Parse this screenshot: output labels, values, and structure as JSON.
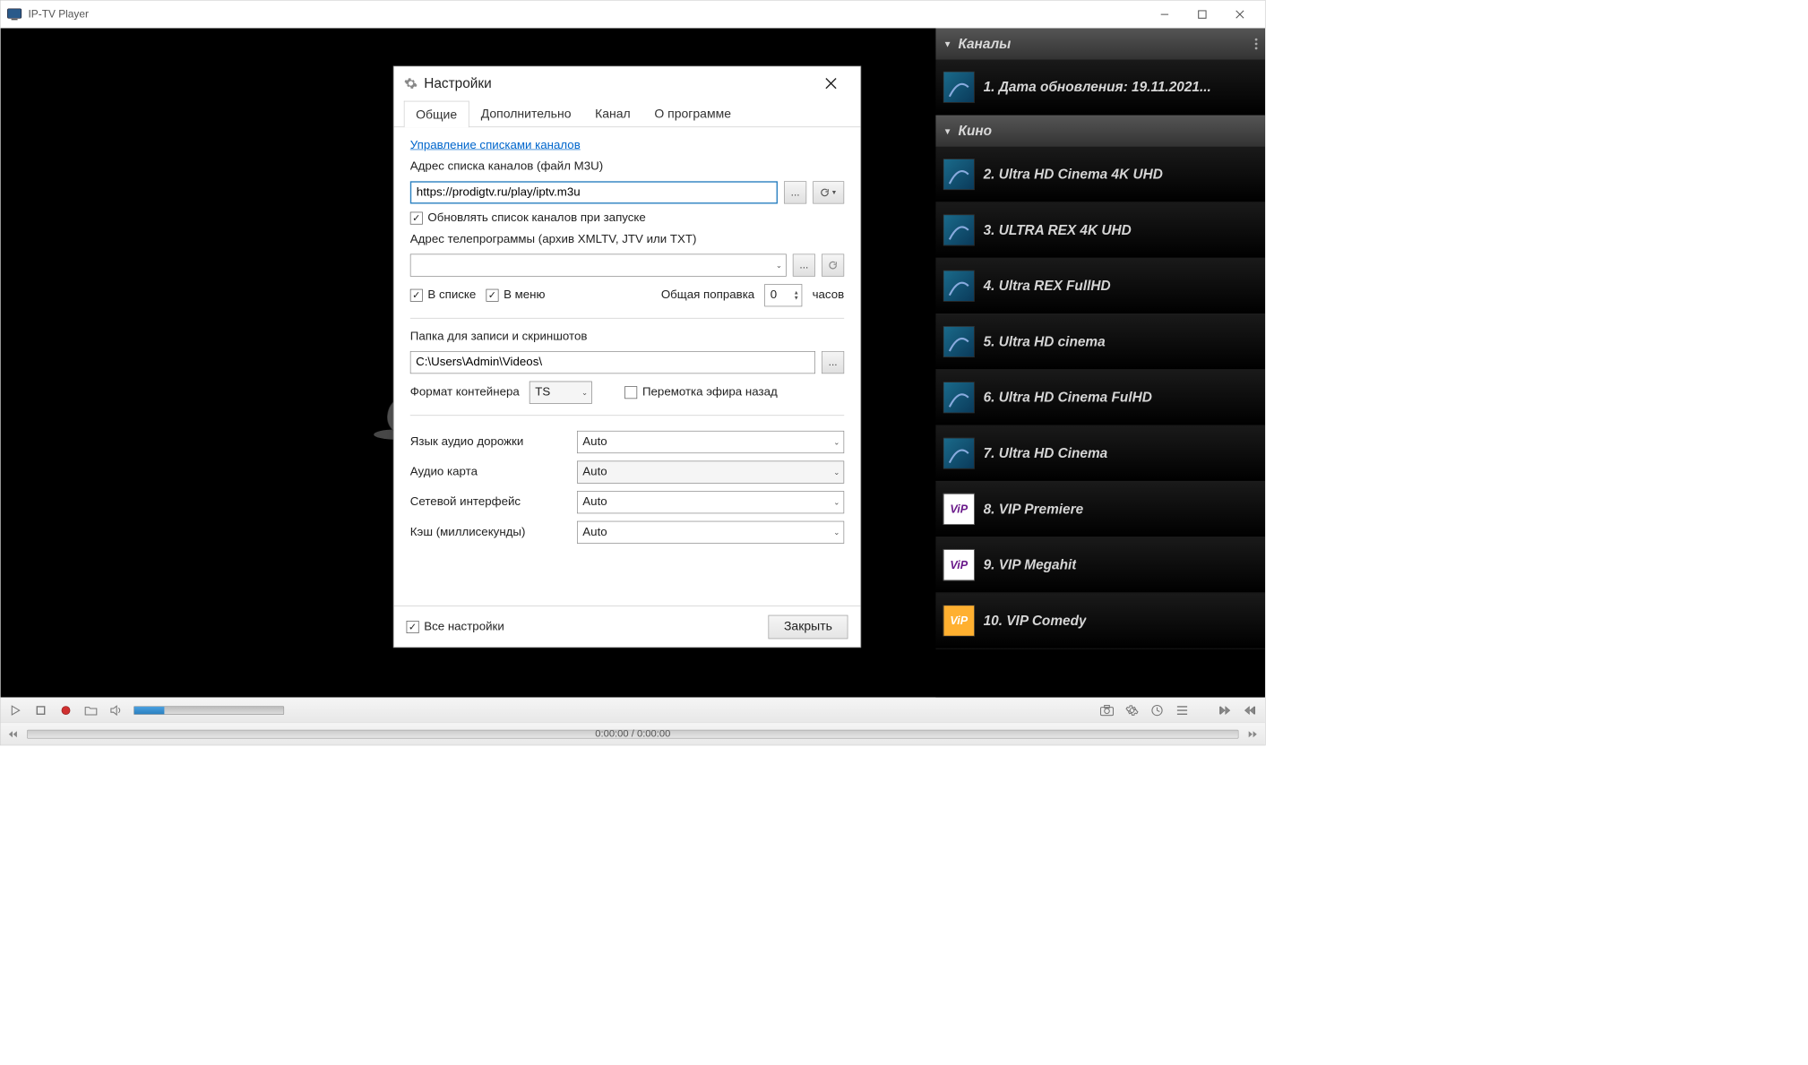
{
  "titlebar": {
    "title": "IP-TV Player"
  },
  "sidebar": {
    "group1": {
      "title": "Каналы"
    },
    "ch1": "1. Дата обновления: 19.11.2021...",
    "group2": {
      "title": "Кино"
    },
    "channels": [
      "2. Ultra HD Cinema 4K UHD",
      "3. ULTRA REX 4K UHD",
      "4. Ultra REX FullHD",
      "5. Ultra HD cinema",
      "6. Ultra HD Cinema FulHD",
      "7. Ultra HD Cinema",
      "8. VIP Premiere",
      "9. VIP Megahit",
      "10. VIP Comedy"
    ]
  },
  "seek": {
    "time": "0:00:00 / 0:00:00"
  },
  "settings": {
    "title": "Настройки",
    "tabs": {
      "general": "Общие",
      "advanced": "Дополнительно",
      "channel": "Канал",
      "about": "О программе"
    },
    "link_manage_lists": "Управление списками каналов",
    "label_m3u": "Адрес списка каналов (файл M3U)",
    "m3u_value": "https://prodigtv.ru/play/iptv.m3u",
    "cb_update_on_start": "Обновлять список каналов при запуске",
    "label_epg": "Адрес телепрограммы (архив XMLTV, JTV или TXT)",
    "epg_value": "",
    "cb_inlist": "В списке",
    "cb_inmenu": "В меню",
    "label_offset": "Общая поправка",
    "offset_value": "0",
    "label_hours": "часов",
    "label_rec_folder": "Папка для записи и скриншотов",
    "rec_folder_value": "C:\\Users\\Admin\\Videos\\",
    "label_container": "Формат контейнера",
    "container_value": "TS",
    "cb_rewind": "Перемотка эфира назад",
    "label_audio_lang": "Язык аудио дорожки",
    "label_audio_card": "Аудио карта",
    "label_net_iface": "Сетевой интерфейс",
    "label_cache": "Кэш (миллисекунды)",
    "val_auto": "Auto",
    "cb_all_settings": "Все настройки",
    "btn_close": "Закрыть"
  }
}
